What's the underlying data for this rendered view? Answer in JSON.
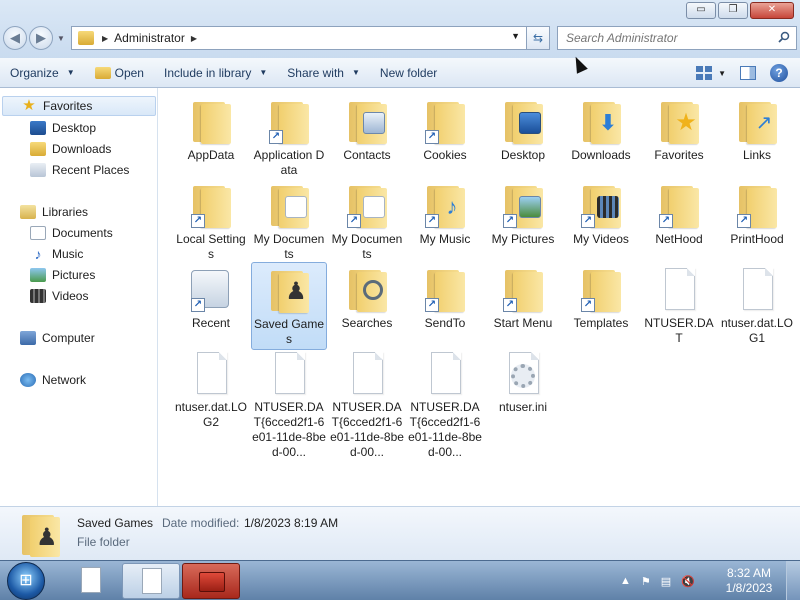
{
  "window": {
    "minimize_label": "▭",
    "restore_label": "❐",
    "close_label": "✕"
  },
  "address": {
    "crumb": "Administrator",
    "search_placeholder": "Search Administrator"
  },
  "toolbar": {
    "organize": "Organize",
    "open": "Open",
    "include": "Include in library",
    "share": "Share with",
    "new_folder": "New folder"
  },
  "sidebar": {
    "favorites": "Favorites",
    "desktop": "Desktop",
    "downloads": "Downloads",
    "recent_places": "Recent Places",
    "libraries": "Libraries",
    "documents": "Documents",
    "music": "Music",
    "pictures": "Pictures",
    "videos": "Videos",
    "computer": "Computer",
    "network": "Network"
  },
  "files": [
    {
      "label": "AppData",
      "kind": "folder"
    },
    {
      "label": "Application Data",
      "kind": "folder-shortcut"
    },
    {
      "label": "Contacts",
      "kind": "folder"
    },
    {
      "label": "Cookies",
      "kind": "folder-shortcut"
    },
    {
      "label": "Desktop",
      "kind": "folder"
    },
    {
      "label": "Downloads",
      "kind": "folder"
    },
    {
      "label": "Favorites",
      "kind": "folder"
    },
    {
      "label": "Links",
      "kind": "folder"
    },
    {
      "label": "Local Settings",
      "kind": "folder-shortcut"
    },
    {
      "label": "My Documents",
      "kind": "folder"
    },
    {
      "label": "My Documents",
      "kind": "folder-shortcut"
    },
    {
      "label": "My Music",
      "kind": "folder-shortcut"
    },
    {
      "label": "My Pictures",
      "kind": "folder-shortcut"
    },
    {
      "label": "My Videos",
      "kind": "folder-shortcut"
    },
    {
      "label": "NetHood",
      "kind": "folder-shortcut"
    },
    {
      "label": "PrintHood",
      "kind": "folder-shortcut"
    },
    {
      "label": "Recent",
      "kind": "shortcut"
    },
    {
      "label": "Saved Games",
      "kind": "folder"
    },
    {
      "label": "Searches",
      "kind": "folder"
    },
    {
      "label": "SendTo",
      "kind": "folder-shortcut"
    },
    {
      "label": "Start Menu",
      "kind": "folder-shortcut"
    },
    {
      "label": "Templates",
      "kind": "folder-shortcut"
    },
    {
      "label": "NTUSER.DAT",
      "kind": "file"
    },
    {
      "label": "ntuser.dat.LOG1",
      "kind": "file"
    },
    {
      "label": "ntuser.dat.LOG2",
      "kind": "file"
    },
    {
      "label": "NTUSER.DAT{6cced2f1-6e01-11de-8bed-00...",
      "kind": "file"
    },
    {
      "label": "NTUSER.DAT{6cced2f1-6e01-11de-8bed-00...",
      "kind": "file"
    },
    {
      "label": "NTUSER.DAT{6cced2f1-6e01-11de-8bed-00...",
      "kind": "file"
    },
    {
      "label": "ntuser.ini",
      "kind": "file"
    }
  ],
  "details": {
    "name": "Saved Games",
    "modified_label": "Date modified:",
    "modified_value": "1/8/2023 8:19 AM",
    "type": "File folder"
  },
  "taskbar": {
    "time": "8:32 AM",
    "date": "1/8/2023"
  }
}
